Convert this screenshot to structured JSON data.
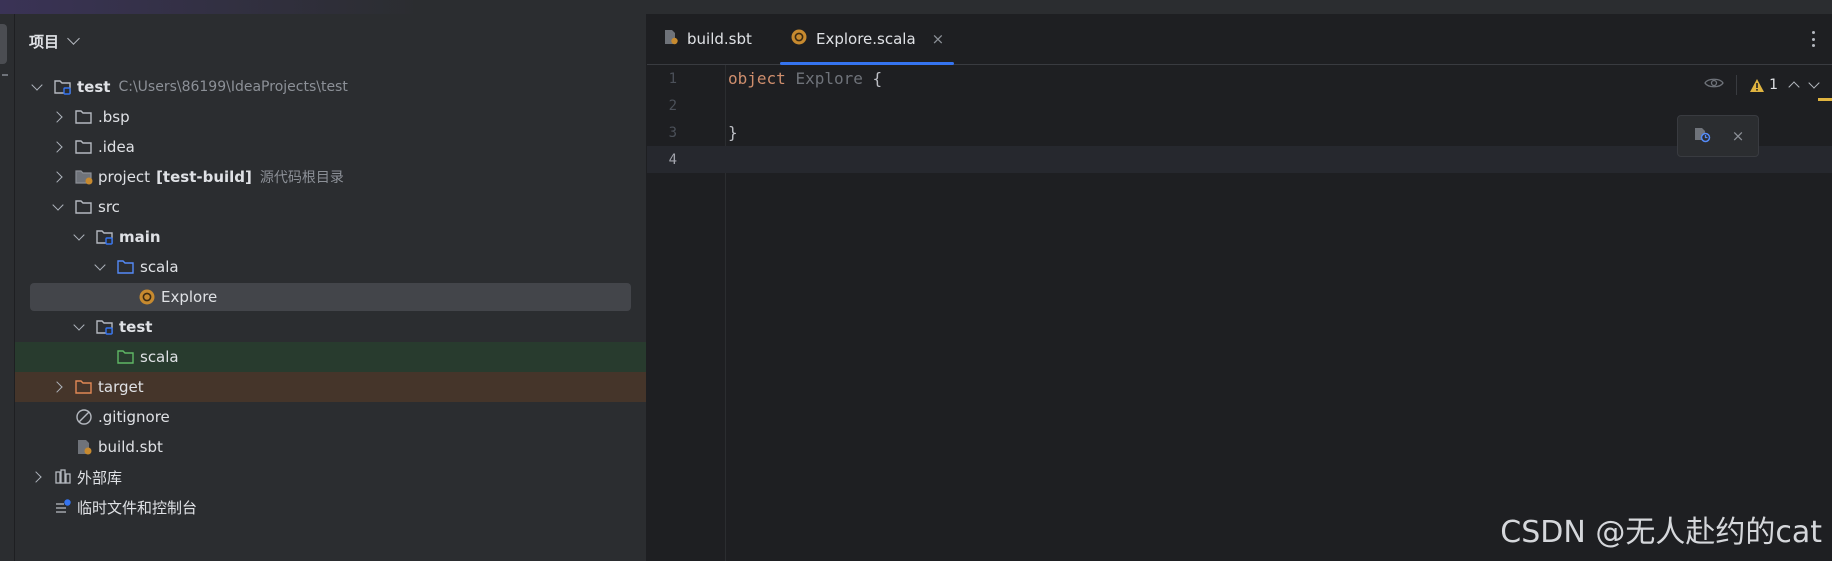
{
  "project_panel": {
    "title": "项目",
    "tree": [
      {
        "name": "test",
        "path": "C:\\Users\\86199\\IdeaProjects\\test",
        "bold": true
      },
      {
        "name": ".bsp"
      },
      {
        "name": ".idea"
      },
      {
        "name": "project",
        "tag": "[test-build]",
        "hint": "源代码根目录"
      },
      {
        "name": "src"
      },
      {
        "name": "main",
        "bold": true
      },
      {
        "name": "scala"
      },
      {
        "name": "Explore"
      },
      {
        "name": "test",
        "bold": true
      },
      {
        "name": "scala"
      },
      {
        "name": "target"
      },
      {
        "name": ".gitignore"
      },
      {
        "name": "build.sbt"
      },
      {
        "name": "外部库"
      },
      {
        "name": "临时文件和控制台"
      }
    ]
  },
  "editor": {
    "tabs": [
      {
        "label": "build.sbt"
      },
      {
        "label": "Explore.scala",
        "active": true
      }
    ],
    "close_glyph": "×",
    "line_numbers": [
      "1",
      "2",
      "3",
      "4"
    ],
    "code": {
      "kw": "object",
      "name": "Explore",
      "open_brace": "{",
      "close_brace": "}"
    },
    "warning_count": "1"
  },
  "colors": {
    "keyword": "#cf8e6d",
    "identifier": "#6f737a",
    "accent": "#3574f0",
    "warning": "#e0b440",
    "scala_badge": "#c78a2f"
  },
  "watermark": "CSDN @无人赴约的cat"
}
